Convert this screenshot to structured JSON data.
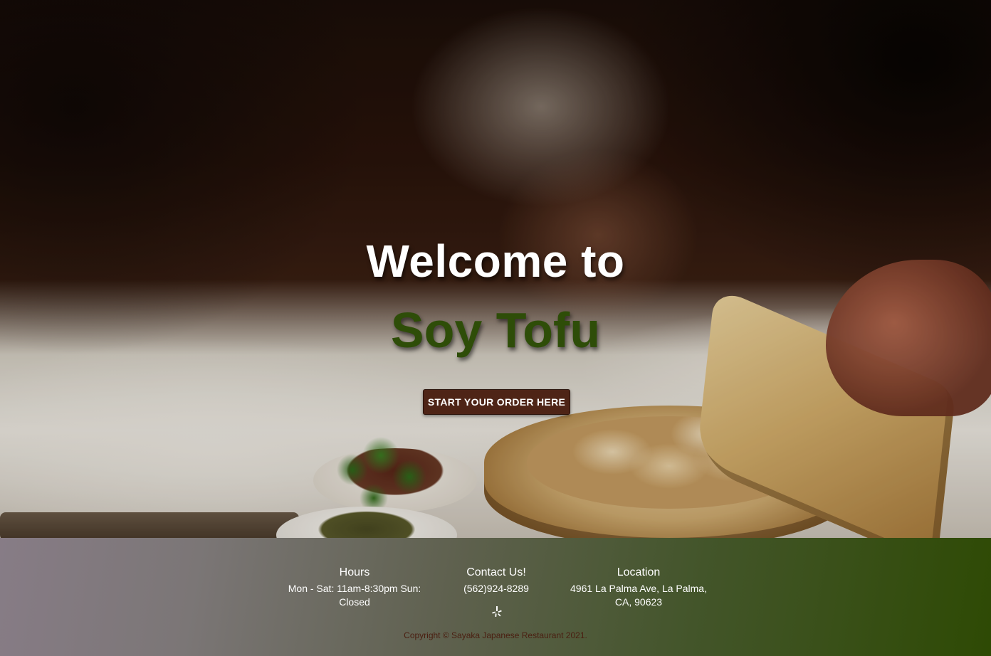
{
  "hero": {
    "welcome_text": "Welcome to",
    "brand_name": "Soy Tofu",
    "order_button_label": "START YOUR ORDER HERE"
  },
  "footer": {
    "hours": {
      "heading": "Hours",
      "text": "Mon - Sat: 11am-8:30pm Sun: Closed"
    },
    "contact": {
      "heading": "Contact Us!",
      "phone": "(562)924-8289",
      "social_icon": "yelp-icon"
    },
    "location": {
      "heading": "Location",
      "address": "4961 La Palma Ave, La Palma, CA, 90623"
    },
    "copyright": "Copyright © Sayaka Japanese Restaurant 2021."
  },
  "colors": {
    "brand_green": "#2e4d08",
    "button_brown": "#4e2416",
    "copyright_text": "#4a1e10"
  }
}
